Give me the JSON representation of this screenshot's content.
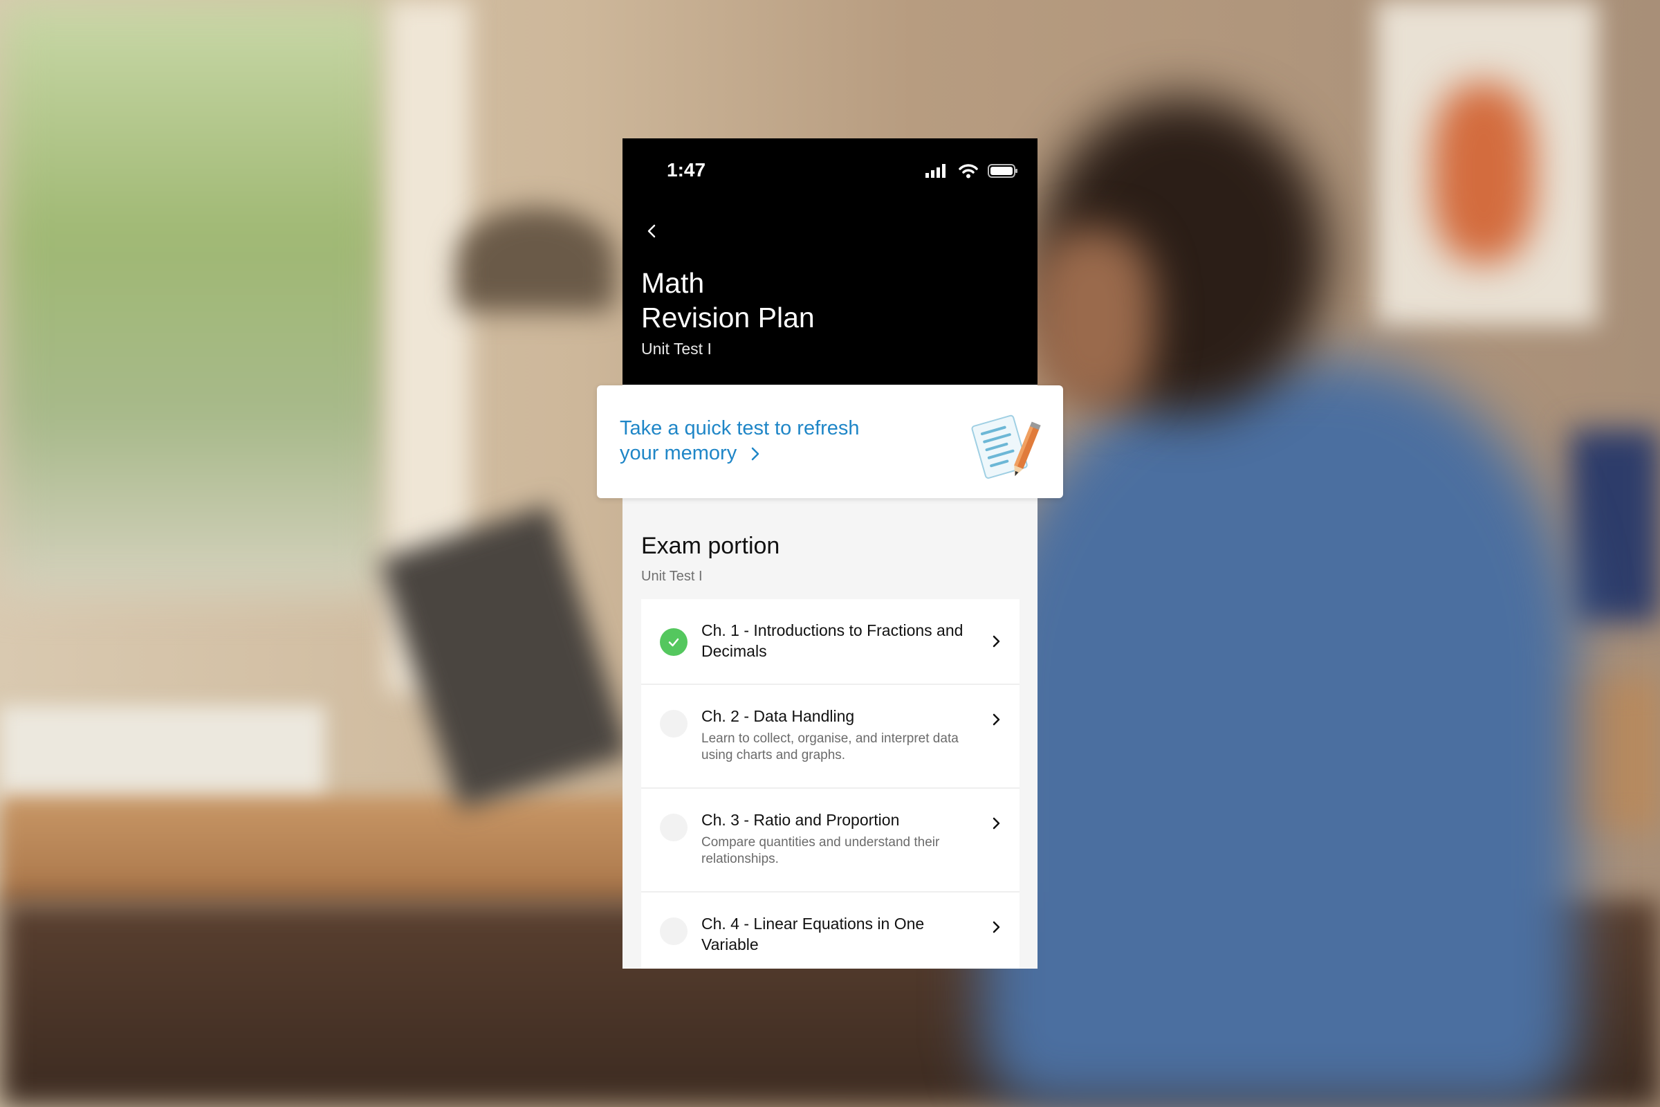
{
  "status_bar": {
    "time": "1:47"
  },
  "header": {
    "title_line1": "Math",
    "title_line2": "Revision Plan",
    "subtitle": "Unit Test I"
  },
  "promo": {
    "line1": "Take a quick test to refresh",
    "line2": "your memory"
  },
  "exam_portion": {
    "title": "Exam portion",
    "subtitle": "Unit Test I",
    "chapters": [
      {
        "title": "Ch. 1 - Introductions to Fractions and Decimals",
        "description": "",
        "completed": true
      },
      {
        "title": "Ch. 2 - Data Handling",
        "description": "Learn to collect, organise, and interpret data using charts and graphs.",
        "completed": false
      },
      {
        "title": "Ch. 3 - Ratio and Proportion",
        "description": "Compare quantities and understand their relationships.",
        "completed": false
      },
      {
        "title": "Ch. 4 - Linear Equations in One Variable",
        "description": "",
        "completed": false
      }
    ]
  },
  "colors": {
    "accent": "#1f86c7",
    "header_bg": "#000000",
    "complete": "#54c75e"
  }
}
